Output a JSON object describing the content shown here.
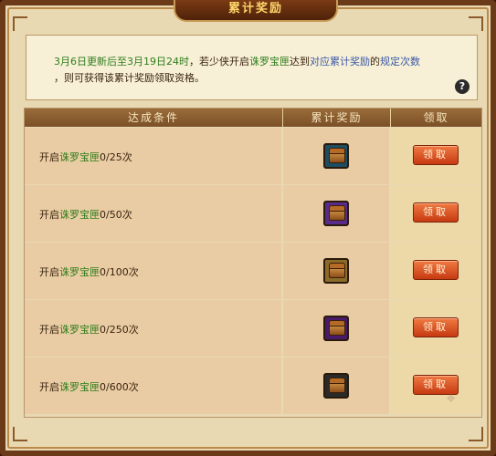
{
  "panel": {
    "title": "累计奖励"
  },
  "notice": {
    "date_range": "3月6日更新后至3月19日24时",
    "text_part1": "，若少侠开启",
    "item_name": "诛罗宝匣",
    "text_part2": "达到",
    "reward_phrase": "对应累计奖励",
    "text_part3": "的",
    "count_phrase": "规定次数",
    "line2": "，则可获得该累计奖励领取资格。",
    "help_label": "?"
  },
  "table": {
    "headers": {
      "condition": "达成条件",
      "reward": "累计奖励",
      "claim": "领取"
    },
    "rows": [
      {
        "prefix": "开启",
        "item": "诛罗宝匣",
        "progress": "0/25次",
        "icon": "bronze-treasure-chest-icon",
        "claim_label": "领取"
      },
      {
        "prefix": "开启",
        "item": "诛罗宝匣",
        "progress": "0/50次",
        "icon": "purple-treasure-chest-icon",
        "claim_label": "领取"
      },
      {
        "prefix": "开启",
        "item": "诛罗宝匣",
        "progress": "0/100次",
        "icon": "gold-treasure-chest-icon",
        "claim_label": "领取"
      },
      {
        "prefix": "开启",
        "item": "诛罗宝匣",
        "progress": "0/250次",
        "icon": "jewel-treasure-chest-icon",
        "claim_label": "领取"
      },
      {
        "prefix": "开启",
        "item": "诛罗宝匣",
        "progress": "0/600次",
        "icon": "ornate-treasure-chest-icon",
        "claim_label": "领取"
      }
    ]
  },
  "colors": {
    "highlight_green": "#2e7d1a",
    "highlight_blue": "#3a5aa8",
    "button_red": "#c73a12"
  }
}
